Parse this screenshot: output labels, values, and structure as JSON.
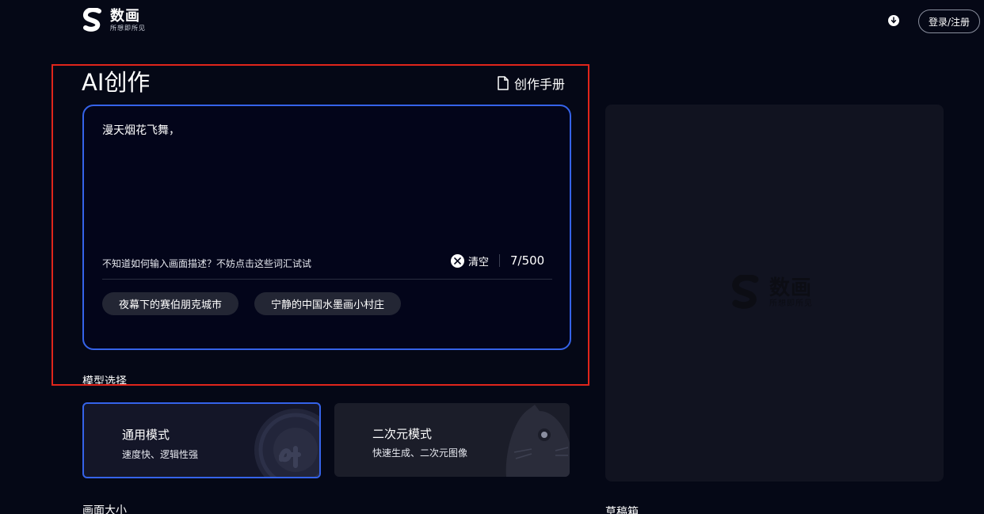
{
  "brand": {
    "name": "数画",
    "slogan": "所想即所见"
  },
  "header": {
    "login_label": "登录/注册",
    "download_icon": "download-icon"
  },
  "creation": {
    "title": "AI创作",
    "manual_label": "创作手册",
    "prompt_value": "漫天烟花飞舞，",
    "hint": "不知道如何输入画面描述？不妨点击这些词汇试试",
    "clear_label": "清空",
    "counter": "7/500",
    "suggestions": [
      "夜幕下的赛伯朋克城市",
      "宁静的中国水墨画小村庄"
    ]
  },
  "model": {
    "label": "模型选择",
    "modes": [
      {
        "title": "通用模式",
        "desc": "速度快、逻辑性强",
        "selected": true
      },
      {
        "title": "二次元模式",
        "desc": "快速生成、二次元图像",
        "selected": false
      }
    ]
  },
  "size_label": "画面大小",
  "draft_label": "草稿箱",
  "colors": {
    "accent": "#3563e9",
    "background": "#050816",
    "highlight_frame": "#e0251b"
  }
}
